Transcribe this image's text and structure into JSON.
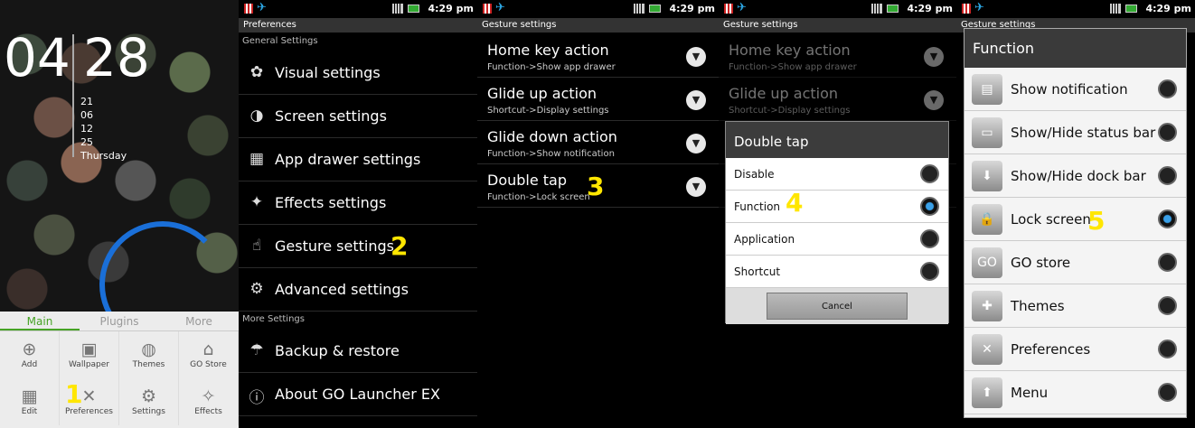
{
  "status": {
    "time": "4:29 pm"
  },
  "home": {
    "hour": "04",
    "minute": "28",
    "date_lines": [
      "21",
      "06",
      "12",
      "25",
      "Thursday"
    ],
    "tabs": [
      "Main",
      "Plugins",
      "More"
    ],
    "items": [
      {
        "label": "Add",
        "icon": "add-icon",
        "glyph": "⊕"
      },
      {
        "label": "Wallpaper",
        "icon": "wallpaper-icon",
        "glyph": "▣"
      },
      {
        "label": "Themes",
        "icon": "palette-icon",
        "glyph": "◍"
      },
      {
        "label": "GO Store",
        "icon": "store-icon",
        "glyph": "⌂"
      },
      {
        "label": "Edit",
        "icon": "grid-icon",
        "glyph": "▦"
      },
      {
        "label": "Preferences",
        "icon": "tools-icon",
        "glyph": "✕"
      },
      {
        "label": "Settings",
        "icon": "gear-icon",
        "glyph": "⚙"
      },
      {
        "label": "Effects",
        "icon": "effects-icon",
        "glyph": "✧"
      }
    ],
    "step": "1"
  },
  "preferences": {
    "header": "Preferences",
    "section_general": "General Settings",
    "general": [
      {
        "label": "Visual settings",
        "glyph": "✿"
      },
      {
        "label": "Screen settings",
        "glyph": "◑"
      },
      {
        "label": "App drawer settings",
        "glyph": "▦"
      },
      {
        "label": "Effects settings",
        "glyph": "✦"
      },
      {
        "label": "Gesture settings",
        "glyph": "☝"
      },
      {
        "label": "Advanced settings",
        "glyph": "⚙"
      }
    ],
    "section_more": "More Settings",
    "more": [
      {
        "label": "Backup & restore",
        "glyph": "☂"
      },
      {
        "label": "About GO Launcher EX",
        "glyph": "ⓘ"
      }
    ],
    "step": "2"
  },
  "gesture": {
    "header": "Gesture settings",
    "rows": [
      {
        "title": "Home key action",
        "sub": "Function->Show app drawer"
      },
      {
        "title": "Glide up action",
        "sub": "Shortcut->Display settings"
      },
      {
        "title": "Glide down action",
        "sub": "Function->Show notification"
      },
      {
        "title": "Double tap",
        "sub": "Function->Lock screen"
      }
    ],
    "step": "3"
  },
  "double_tap_dialog": {
    "title": "Double tap",
    "options": [
      "Disable",
      "Function",
      "Application",
      "Shortcut"
    ],
    "selected": "Function",
    "cancel": "Cancel",
    "step": "4"
  },
  "function_dialog": {
    "title": "Function",
    "options": [
      {
        "label": "Show notification",
        "icon": "notification-icon",
        "glyph": "▤"
      },
      {
        "label": "Show/Hide status bar",
        "icon": "status-bar-icon",
        "glyph": "▭"
      },
      {
        "label": "Show/Hide dock bar",
        "icon": "dock-bar-icon",
        "glyph": "⬇"
      },
      {
        "label": "Lock screen",
        "icon": "lock-icon",
        "glyph": "🔒"
      },
      {
        "label": "GO store",
        "icon": "go-store-icon",
        "glyph": "GO"
      },
      {
        "label": "Themes",
        "icon": "themes-icon",
        "glyph": "✚"
      },
      {
        "label": "Preferences",
        "icon": "preferences-icon",
        "glyph": "✕"
      },
      {
        "label": "Menu",
        "icon": "menu-icon",
        "glyph": "⬆"
      }
    ],
    "selected": "Lock screen",
    "step": "5"
  }
}
